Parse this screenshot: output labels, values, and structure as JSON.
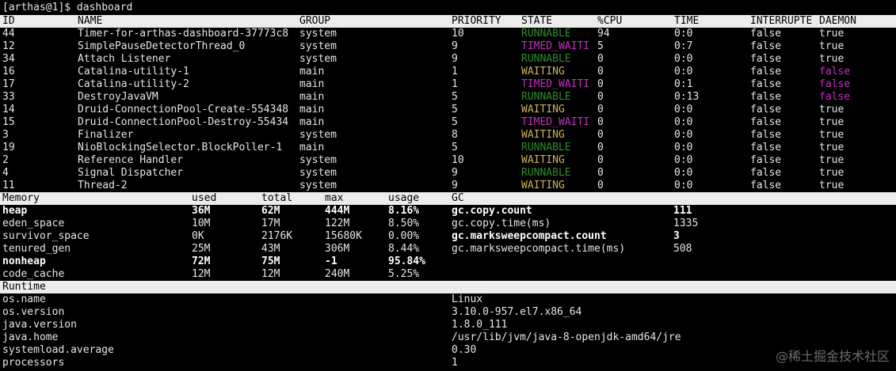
{
  "prompt": "[arthas@1]$ dashboard",
  "threads": {
    "headers": [
      "ID",
      "NAME",
      "GROUP",
      "PRIORITY",
      "STATE",
      "%CPU",
      "TIME",
      "INTERRUPTE",
      "DAEMON"
    ],
    "rows": [
      {
        "id": "44",
        "name": "Timer-for-arthas-dashboard-37773c8",
        "group": "system",
        "priority": "10",
        "state": "RUNNABLE",
        "cpu": "94",
        "time": "0:0",
        "interrupted": "false",
        "daemon": "true"
      },
      {
        "id": "12",
        "name": "SimplePauseDetectorThread_0",
        "group": "system",
        "priority": "9",
        "state": "TIMED_WAITI",
        "cpu": "5",
        "time": "0:7",
        "interrupted": "false",
        "daemon": "true"
      },
      {
        "id": "34",
        "name": "Attach Listener",
        "group": "system",
        "priority": "9",
        "state": "RUNNABLE",
        "cpu": "0",
        "time": "0:0",
        "interrupted": "false",
        "daemon": "true"
      },
      {
        "id": "16",
        "name": "Catalina-utility-1",
        "group": "main",
        "priority": "1",
        "state": "WAITING",
        "cpu": "0",
        "time": "0:0",
        "interrupted": "false",
        "daemon": "false"
      },
      {
        "id": "17",
        "name": "Catalina-utility-2",
        "group": "main",
        "priority": "1",
        "state": "TIMED_WAITI",
        "cpu": "0",
        "time": "0:1",
        "interrupted": "false",
        "daemon": "false"
      },
      {
        "id": "33",
        "name": "DestroyJavaVM",
        "group": "main",
        "priority": "5",
        "state": "RUNNABLE",
        "cpu": "0",
        "time": "0:13",
        "interrupted": "false",
        "daemon": "false"
      },
      {
        "id": "14",
        "name": "Druid-ConnectionPool-Create-554348",
        "group": "main",
        "priority": "5",
        "state": "WAITING",
        "cpu": "0",
        "time": "0:0",
        "interrupted": "false",
        "daemon": "true"
      },
      {
        "id": "15",
        "name": "Druid-ConnectionPool-Destroy-55434",
        "group": "main",
        "priority": "5",
        "state": "TIMED_WAITI",
        "cpu": "0",
        "time": "0:0",
        "interrupted": "false",
        "daemon": "true"
      },
      {
        "id": "3",
        "name": "Finalizer",
        "group": "system",
        "priority": "8",
        "state": "WAITING",
        "cpu": "0",
        "time": "0:0",
        "interrupted": "false",
        "daemon": "true"
      },
      {
        "id": "19",
        "name": "NioBlockingSelector.BlockPoller-1",
        "group": "main",
        "priority": "5",
        "state": "RUNNABLE",
        "cpu": "0",
        "time": "0:0",
        "interrupted": "false",
        "daemon": "true"
      },
      {
        "id": "2",
        "name": "Reference Handler",
        "group": "system",
        "priority": "10",
        "state": "WAITING",
        "cpu": "0",
        "time": "0:0",
        "interrupted": "false",
        "daemon": "true"
      },
      {
        "id": "4",
        "name": "Signal Dispatcher",
        "group": "system",
        "priority": "9",
        "state": "RUNNABLE",
        "cpu": "0",
        "time": "0:0",
        "interrupted": "false",
        "daemon": "true"
      },
      {
        "id": "11",
        "name": "Thread-2",
        "group": "system",
        "priority": "9",
        "state": "WAITING",
        "cpu": "0",
        "time": "0:0",
        "interrupted": "false",
        "daemon": "true"
      }
    ]
  },
  "memory": {
    "headers": [
      "Memory",
      "used",
      "total",
      "max",
      "usage",
      "GC"
    ],
    "rows": [
      {
        "name": "heap",
        "used": "36M",
        "total": "62M",
        "max": "444M",
        "usage": "8.16%",
        "bold": true
      },
      {
        "name": "eden_space",
        "used": "10M",
        "total": "17M",
        "max": "122M",
        "usage": "8.50%",
        "bold": false
      },
      {
        "name": "survivor_space",
        "used": "0K",
        "total": "2176K",
        "max": "15680K",
        "usage": "0.00%",
        "bold": false
      },
      {
        "name": "tenured_gen",
        "used": "25M",
        "total": "43M",
        "max": "306M",
        "usage": "8.44%",
        "bold": false
      },
      {
        "name": "nonheap",
        "used": "72M",
        "total": "75M",
        "max": "-1",
        "usage": "95.84%",
        "bold": true
      },
      {
        "name": "code_cache",
        "used": "12M",
        "total": "12M",
        "max": "240M",
        "usage": "5.25%",
        "bold": false
      }
    ],
    "gc": [
      {
        "name": "gc.copy.count",
        "value": "111",
        "bold": true
      },
      {
        "name": "gc.copy.time(ms)",
        "value": "1335",
        "bold": false
      },
      {
        "name": "gc.marksweepcompact.count",
        "value": "3",
        "bold": true
      },
      {
        "name": "gc.marksweepcompact.time(ms)",
        "value": "508",
        "bold": false
      }
    ]
  },
  "runtime": {
    "header": "Runtime",
    "rows": [
      {
        "key": "os.name",
        "value": "Linux"
      },
      {
        "key": "os.version",
        "value": "3.10.0-957.el7.x86_64"
      },
      {
        "key": "java.version",
        "value": "1.8.0_111"
      },
      {
        "key": "java.home",
        "value": "/usr/lib/jvm/java-8-openjdk-amd64/jre"
      },
      {
        "key": "systemload.average",
        "value": "0.30"
      },
      {
        "key": "processors",
        "value": "1"
      }
    ]
  },
  "watermark": "@稀土掘金技术社区",
  "colors": {
    "background": "#000000",
    "header_bg": "#ececec",
    "runnable": "#2e8b2e",
    "timed_waiting": "#c42fc4",
    "waiting": "#c9b455",
    "daemon_false": "#c42fc4"
  }
}
